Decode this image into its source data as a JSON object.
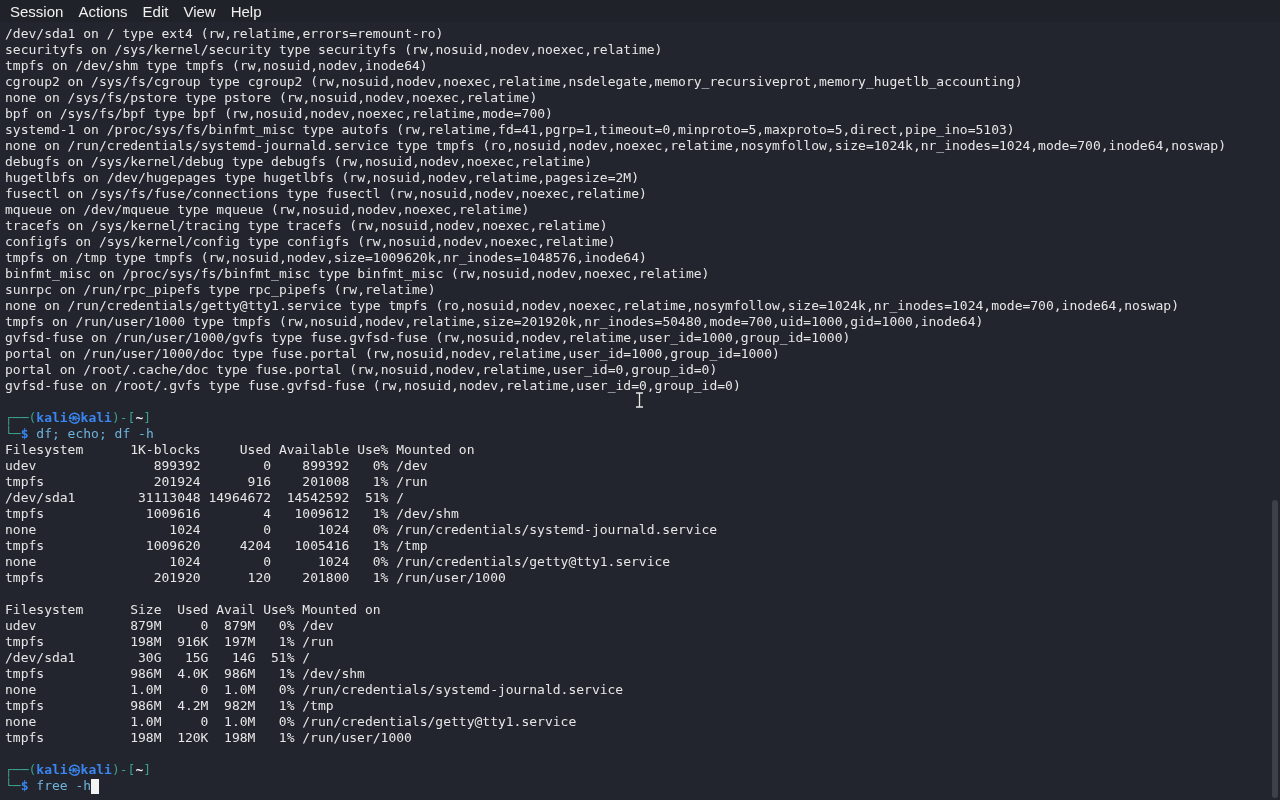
{
  "menu_bar": {
    "items": [
      "Session",
      "Actions",
      "Edit",
      "View",
      "Help"
    ]
  },
  "blocks": [
    {
      "kind": "output",
      "lines": [
        "/dev/sda1 on / type ext4 (rw,relatime,errors=remount-ro)",
        "securityfs on /sys/kernel/security type securityfs (rw,nosuid,nodev,noexec,relatime)",
        "tmpfs on /dev/shm type tmpfs (rw,nosuid,nodev,inode64)",
        "cgroup2 on /sys/fs/cgroup type cgroup2 (rw,nosuid,nodev,noexec,relatime,nsdelegate,memory_recursiveprot,memory_hugetlb_accounting)",
        "none on /sys/fs/pstore type pstore (rw,nosuid,nodev,noexec,relatime)",
        "bpf on /sys/fs/bpf type bpf (rw,nosuid,nodev,noexec,relatime,mode=700)",
        "systemd-1 on /proc/sys/fs/binfmt_misc type autofs (rw,relatime,fd=41,pgrp=1,timeout=0,minproto=5,maxproto=5,direct,pipe_ino=5103)",
        "none on /run/credentials/systemd-journald.service type tmpfs (ro,nosuid,nodev,noexec,relatime,nosymfollow,size=1024k,nr_inodes=1024,mode=700,inode64,noswap)",
        "debugfs on /sys/kernel/debug type debugfs (rw,nosuid,nodev,noexec,relatime)",
        "hugetlbfs on /dev/hugepages type hugetlbfs (rw,nosuid,nodev,relatime,pagesize=2M)",
        "fusectl on /sys/fs/fuse/connections type fusectl (rw,nosuid,nodev,noexec,relatime)",
        "mqueue on /dev/mqueue type mqueue (rw,nosuid,nodev,noexec,relatime)",
        "tracefs on /sys/kernel/tracing type tracefs (rw,nosuid,nodev,noexec,relatime)",
        "configfs on /sys/kernel/config type configfs (rw,nosuid,nodev,noexec,relatime)",
        "tmpfs on /tmp type tmpfs (rw,nosuid,nodev,size=1009620k,nr_inodes=1048576,inode64)",
        "binfmt_misc on /proc/sys/fs/binfmt_misc type binfmt_misc (rw,nosuid,nodev,noexec,relatime)",
        "sunrpc on /run/rpc_pipefs type rpc_pipefs (rw,relatime)",
        "none on /run/credentials/getty@tty1.service type tmpfs (ro,nosuid,nodev,noexec,relatime,nosymfollow,size=1024k,nr_inodes=1024,mode=700,inode64,noswap)",
        "tmpfs on /run/user/1000 type tmpfs (rw,nosuid,nodev,relatime,size=201920k,nr_inodes=50480,mode=700,uid=1000,gid=1000,inode64)",
        "gvfsd-fuse on /run/user/1000/gvfs type fuse.gvfsd-fuse (rw,nosuid,nodev,relatime,user_id=1000,group_id=1000)",
        "portal on /run/user/1000/doc type fuse.portal (rw,nosuid,nodev,relatime,user_id=1000,group_id=1000)",
        "portal on /root/.cache/doc type fuse.portal (rw,nosuid,nodev,relatime,user_id=0,group_id=0)",
        "gvfsd-fuse on /root/.gvfs type fuse.gvfsd-fuse (rw,nosuid,nodev,relatime,user_id=0,group_id=0)"
      ]
    },
    {
      "kind": "blank"
    },
    {
      "kind": "prompt",
      "open": "┌──(",
      "user": "kali㉿kali",
      "middle": ")-[",
      "dir": "~",
      "close": "]",
      "corner": "└─",
      "sigil": "$",
      "command": "df; echo; df -h",
      "cursor": false
    },
    {
      "kind": "table",
      "columns": [
        "Filesystem",
        "1K-blocks",
        "Used",
        "Available",
        "Use%",
        "Mounted on"
      ],
      "rows": [
        [
          "udev",
          "899392",
          "0",
          "899392",
          "0%",
          "/dev"
        ],
        [
          "tmpfs",
          "201924",
          "916",
          "201008",
          "1%",
          "/run"
        ],
        [
          "/dev/sda1",
          "31113048",
          "14964672",
          "14542592",
          "51%",
          "/"
        ],
        [
          "tmpfs",
          "1009616",
          "4",
          "1009612",
          "1%",
          "/dev/shm"
        ],
        [
          "none",
          "1024",
          "0",
          "1024",
          "0%",
          "/run/credentials/systemd-journald.service"
        ],
        [
          "tmpfs",
          "1009620",
          "4204",
          "1005416",
          "1%",
          "/tmp"
        ],
        [
          "none",
          "1024",
          "0",
          "1024",
          "0%",
          "/run/credentials/getty@tty1.service"
        ],
        [
          "tmpfs",
          "201920",
          "120",
          "201800",
          "1%",
          "/run/user/1000"
        ]
      ]
    },
    {
      "kind": "blank"
    },
    {
      "kind": "table",
      "columns": [
        "Filesystem",
        "Size",
        "Used",
        "Avail",
        "Use%",
        "Mounted on"
      ],
      "rows": [
        [
          "udev",
          "879M",
          "0",
          "879M",
          "0%",
          "/dev"
        ],
        [
          "tmpfs",
          "198M",
          "916K",
          "197M",
          "1%",
          "/run"
        ],
        [
          "/dev/sda1",
          "30G",
          "15G",
          "14G",
          "51%",
          "/"
        ],
        [
          "tmpfs",
          "986M",
          "4.0K",
          "986M",
          "1%",
          "/dev/shm"
        ],
        [
          "none",
          "1.0M",
          "0",
          "1.0M",
          "0%",
          "/run/credentials/systemd-journald.service"
        ],
        [
          "tmpfs",
          "986M",
          "4.2M",
          "982M",
          "1%",
          "/tmp"
        ],
        [
          "none",
          "1.0M",
          "0",
          "1.0M",
          "0%",
          "/run/credentials/getty@tty1.service"
        ],
        [
          "tmpfs",
          "198M",
          "120K",
          "198M",
          "1%",
          "/run/user/1000"
        ]
      ]
    },
    {
      "kind": "blank"
    },
    {
      "kind": "prompt",
      "open": "┌──(",
      "user": "kali㉿kali",
      "middle": ")-[",
      "dir": "~",
      "close": "]",
      "corner": "└─",
      "sigil": "$",
      "command": "free -h",
      "cursor": true
    }
  ]
}
